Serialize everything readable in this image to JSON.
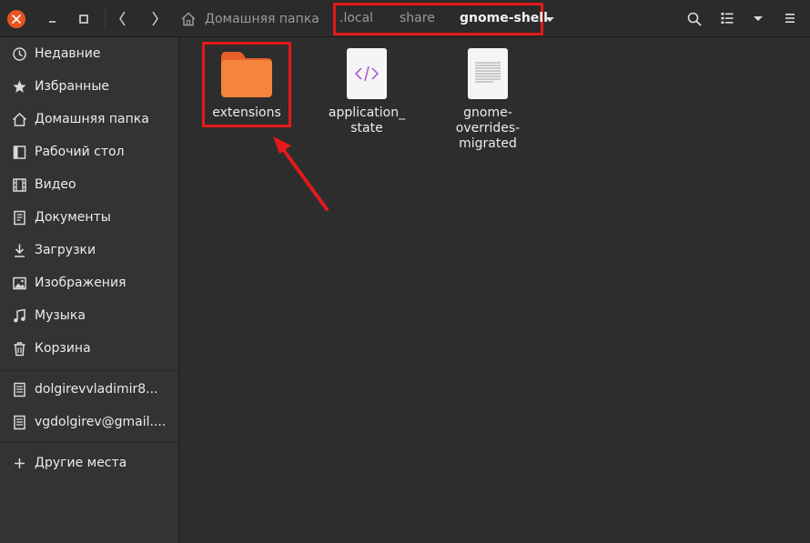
{
  "header": {
    "home_label": "Домашняя папка",
    "path": [
      ".local",
      "share",
      "gnome-shell"
    ]
  },
  "sidebar": {
    "places": [
      {
        "label": "Недавние",
        "icon": "clock-icon"
      },
      {
        "label": "Избранные",
        "icon": "star-icon"
      },
      {
        "label": "Домашняя папка",
        "icon": "home-icon"
      },
      {
        "label": "Рабочий стол",
        "icon": "desktop-icon"
      },
      {
        "label": "Видео",
        "icon": "film-icon"
      },
      {
        "label": "Документы",
        "icon": "document-icon"
      },
      {
        "label": "Загрузки",
        "icon": "download-icon"
      },
      {
        "label": "Изображения",
        "icon": "image-icon"
      },
      {
        "label": "Музыка",
        "icon": "music-icon"
      },
      {
        "label": "Корзина",
        "icon": "trash-icon"
      }
    ],
    "accounts": [
      {
        "label": "dolgirevvladimir8...",
        "icon": "drive-icon"
      },
      {
        "label": "vgdolgirev@gmail....",
        "icon": "drive-icon"
      }
    ],
    "other_locations": "Другие места"
  },
  "files": {
    "extensions": {
      "name": "extensions",
      "icon": "folder-icon"
    },
    "application_state": {
      "line1": "application_",
      "line2": "state",
      "icon": "code-file-icon"
    },
    "gnome_overrides": {
      "line1": "gnome-",
      "line2": "overrides-",
      "line3": "migrated",
      "icon": "text-file-icon"
    }
  },
  "colors": {
    "accent": "#e95420",
    "folder": "#f07030",
    "highlight": "#e21a1a",
    "background": "#2d2d2d",
    "sidebar": "#333333"
  }
}
